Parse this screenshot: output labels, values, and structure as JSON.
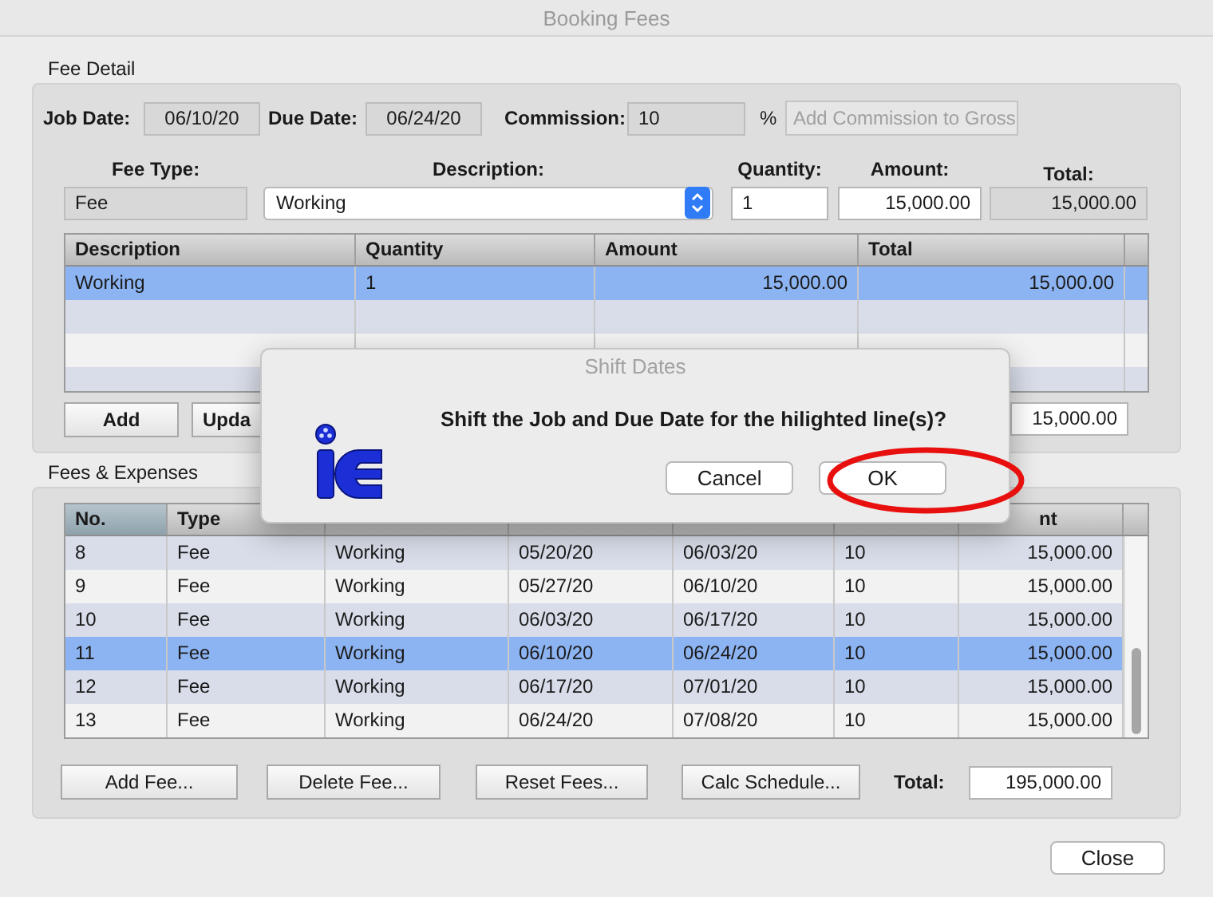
{
  "window": {
    "title": "Booking Fees"
  },
  "fee_detail": {
    "title": "Fee Detail",
    "job_date": {
      "label": "Job Date:",
      "value": "06/10/20"
    },
    "due_date": {
      "label": "Due Date:",
      "value": "06/24/20"
    },
    "commission": {
      "label": "Commission:",
      "value": "10",
      "unit": "%"
    },
    "add_commission_button": {
      "label": "Add Commission to Gross",
      "disabled": true
    },
    "fee_type": {
      "label": "Fee Type:",
      "value": "Fee"
    },
    "description": {
      "label": "Description:",
      "value": "Working"
    },
    "quantity": {
      "label": "Quantity:",
      "value": "1"
    },
    "amount": {
      "label": "Amount:",
      "value": "15,000.00"
    },
    "total": {
      "label": "Total:",
      "value": "15,000.00"
    },
    "table": {
      "columns": [
        "Description",
        "Quantity",
        "Amount",
        "Total"
      ],
      "rows": [
        {
          "cells": [
            "Working",
            "1",
            "15,000.00",
            "15,000.00"
          ],
          "selected": true
        }
      ]
    },
    "buttons": [
      "Add",
      "Upda"
    ],
    "field_value": "15,000.00"
  },
  "fees_expenses": {
    "title": "Fees & Expenses",
    "table": {
      "columns": [
        "No.",
        "Type",
        "",
        "",
        "",
        "",
        "nt"
      ],
      "rows": [
        {
          "cells": [
            "8",
            "Fee",
            "Working",
            "05/20/20",
            "06/03/20",
            "10",
            "15,000.00"
          ],
          "selected": false
        },
        {
          "cells": [
            "9",
            "Fee",
            "Working",
            "05/27/20",
            "06/10/20",
            "10",
            "15,000.00"
          ],
          "selected": false
        },
        {
          "cells": [
            "10",
            "Fee",
            "Working",
            "06/03/20",
            "06/17/20",
            "10",
            "15,000.00"
          ],
          "selected": false
        },
        {
          "cells": [
            "11",
            "Fee",
            "Working",
            "06/10/20",
            "06/24/20",
            "10",
            "15,000.00"
          ],
          "selected": true
        },
        {
          "cells": [
            "12",
            "Fee",
            "Working",
            "06/17/20",
            "07/01/20",
            "10",
            "15,000.00"
          ],
          "selected": false
        },
        {
          "cells": [
            "13",
            "Fee",
            "Working",
            "06/24/20",
            "07/08/20",
            "10",
            "15,000.00"
          ],
          "selected": false
        }
      ]
    },
    "buttons": [
      "Add Fee...",
      "Delete Fee...",
      "Reset Fees...",
      "Calc Schedule..."
    ],
    "total": {
      "label": "Total:",
      "value": "195,000.00"
    }
  },
  "close_button": "Close",
  "dialog": {
    "title": "Shift Dates",
    "message": "Shift the Job and Due Date for the hilighted line(s)?",
    "buttons": [
      "Cancel",
      "OK"
    ]
  }
}
